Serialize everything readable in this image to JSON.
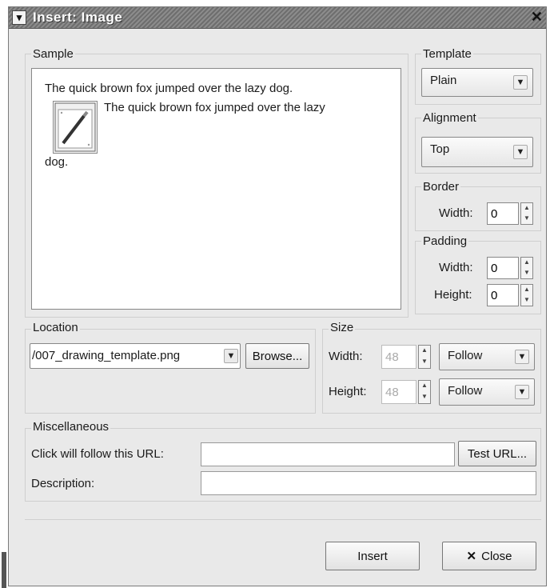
{
  "window": {
    "title": "Insert: Image",
    "menu_glyph": "▾",
    "close_glyph": "✕"
  },
  "sample": {
    "label": "Sample",
    "line1": "The quick brown fox jumped over the lazy dog.",
    "line2": "The quick brown fox jumped over the lazy",
    "line3": "dog.",
    "thumbnail_icon": "pencil-drawing-icon"
  },
  "template": {
    "label": "Template",
    "value": "Plain"
  },
  "alignment": {
    "label": "Alignment",
    "value": "Top"
  },
  "border": {
    "label": "Border",
    "width_label": "Width:",
    "width_value": "0"
  },
  "padding": {
    "label": "Padding",
    "width_label": "Width:",
    "width_value": "0",
    "height_label": "Height:",
    "height_value": "0"
  },
  "location": {
    "label": "Location",
    "value": "/007_drawing_template.png",
    "browse_label": "Browse..."
  },
  "size": {
    "label": "Size",
    "width_label": "Width:",
    "width_value": "48",
    "width_mode": "Follow",
    "height_label": "Height:",
    "height_value": "48",
    "height_mode": "Follow"
  },
  "misc": {
    "label": "Miscellaneous",
    "url_label": "Click will follow this URL:",
    "url_value": "",
    "test_url_label": "Test URL...",
    "description_label": "Description:",
    "description_value": ""
  },
  "actions": {
    "insert_label": "Insert",
    "close_label": "Close",
    "close_icon": "x-icon"
  }
}
